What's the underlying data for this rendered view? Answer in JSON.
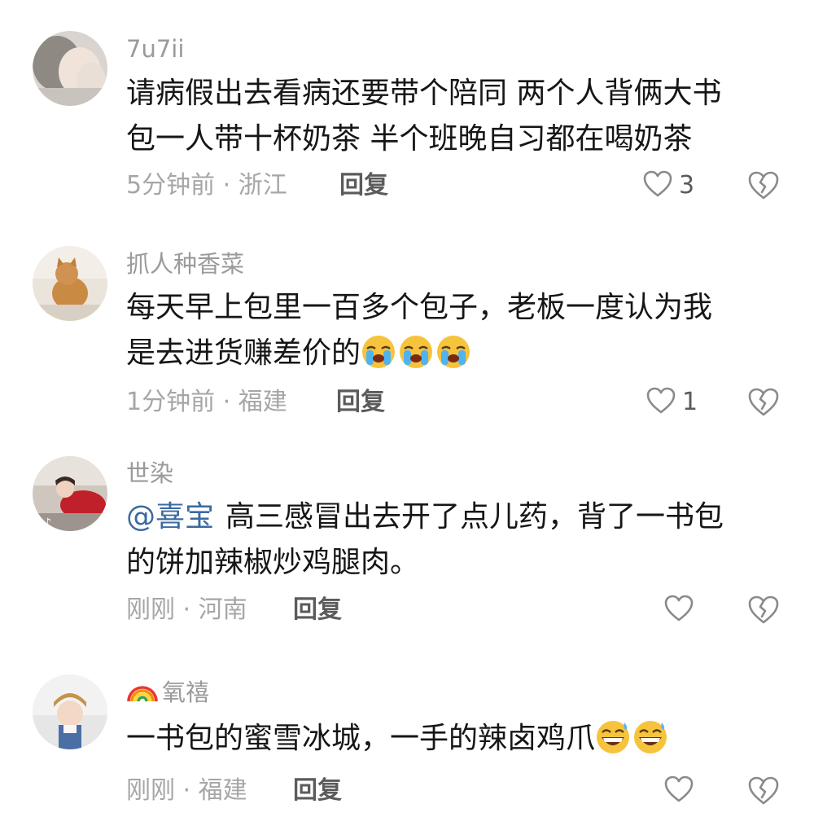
{
  "comments": [
    {
      "username": "7u7ii",
      "lines": [
        "请病假出去看病还要带个陪同 两个人背俩大书",
        "包一人带十杯奶茶 半个班晚自习都在喝奶茶"
      ],
      "meta": "5分钟前 · 浙江",
      "reply": "回复",
      "likes": "3"
    },
    {
      "username": "抓人种香菜",
      "lines": [
        "每天早上包里一百多个包子，老板一度认为我",
        "是去进货赚差价的"
      ],
      "emojis": [
        "crying-face",
        "crying-face",
        "crying-face"
      ],
      "meta": "1分钟前 · 福建",
      "reply": "回复",
      "likes": "1"
    },
    {
      "username": "世染",
      "mention": "@喜宝",
      "lines": [
        "高三感冒出去开了点儿药，背了一书包",
        "的饼加辣椒炒鸡腿肉。"
      ],
      "meta": "刚刚 · 河南",
      "reply": "回复",
      "likes": ""
    },
    {
      "username": "氧禧",
      "username_prefix_icon": "rainbow",
      "lines": [
        "一书包的蜜雪冰城，一手的辣卤鸡爪"
      ],
      "emojis": [
        "grinning-sweat-face",
        "grinning-sweat-face"
      ],
      "meta": "刚刚 · 福建",
      "reply": "回复",
      "likes": ""
    }
  ],
  "colors": {
    "username": "#9a9a9a",
    "text": "#161616",
    "mention": "#3b6aa0",
    "meta": "#a6a6a6",
    "action": "#5b5b5b"
  }
}
